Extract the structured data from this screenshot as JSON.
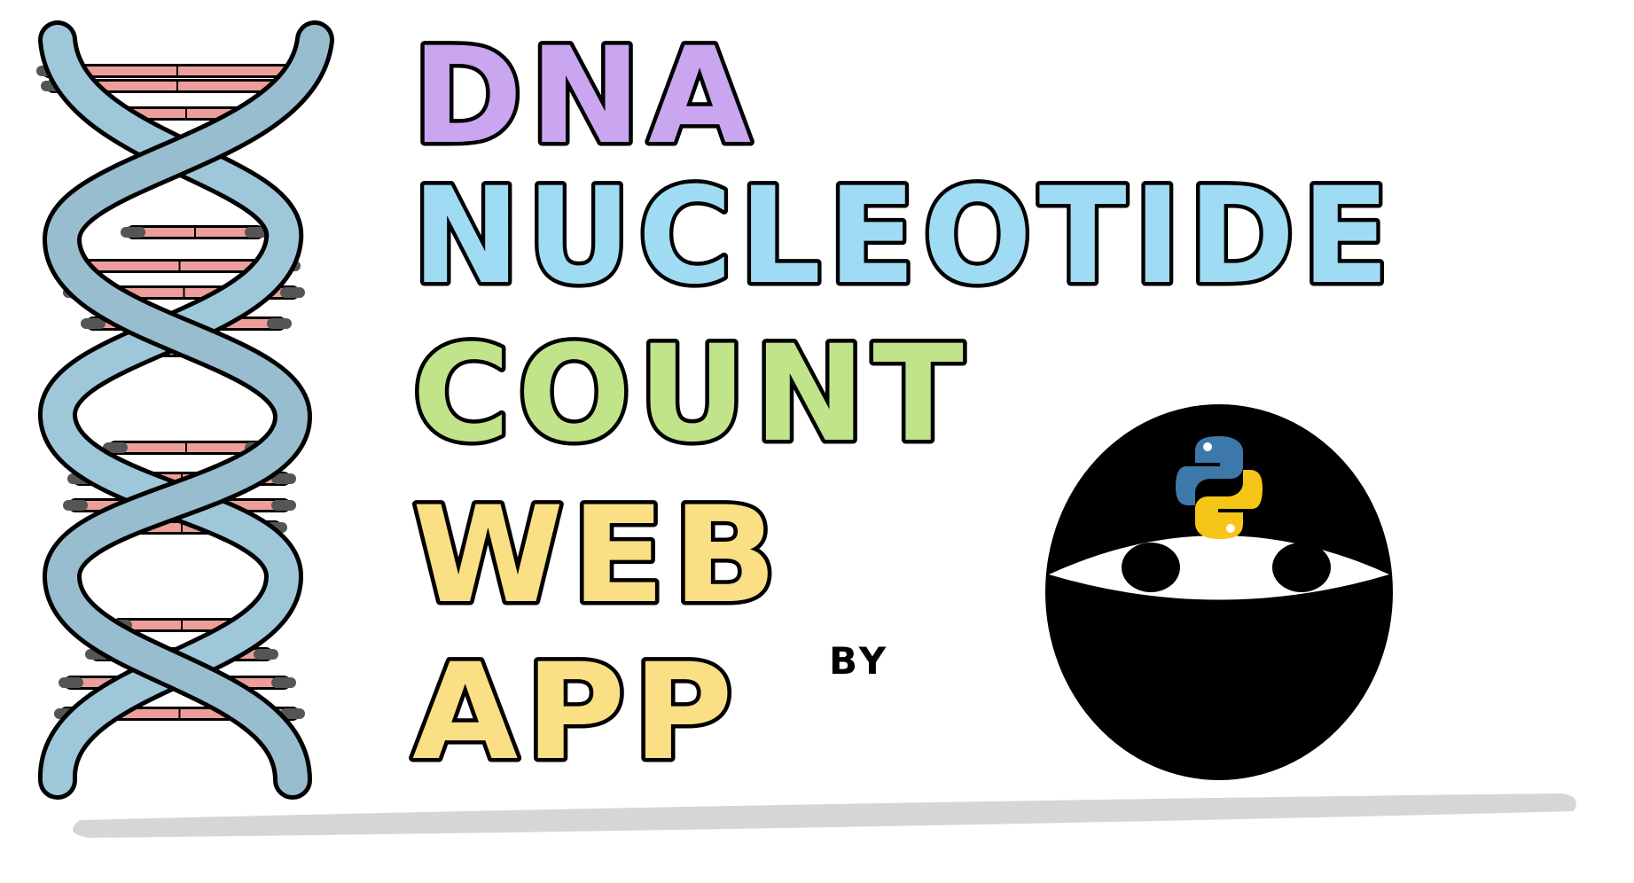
{
  "title_lines": [
    {
      "text": "DNA",
      "color": "#c9a6ef"
    },
    {
      "text": "NUCLEOTIDE",
      "color": "#9fdcf3"
    },
    {
      "text": "COUNT",
      "color": "#c1e48b"
    },
    {
      "text": "WEB",
      "color": "#fbdf85"
    },
    {
      "text": "APP",
      "color": "#fbdf85"
    }
  ],
  "byline": "BY",
  "icons": {
    "dna": "dna-helix-icon",
    "ninja": "ninja-head-icon",
    "python": "python-logo-icon"
  },
  "colors": {
    "helix_strand": "#a8d2e6",
    "base_pair": "#ec9e9a",
    "base_pair_end": "#555555",
    "ninja": "#000000",
    "ninja_eyes_band": "#ffffff",
    "python_blue": "#3c78aa",
    "python_yellow": "#f5c518",
    "ground_shadow": "#d6d6d6"
  }
}
